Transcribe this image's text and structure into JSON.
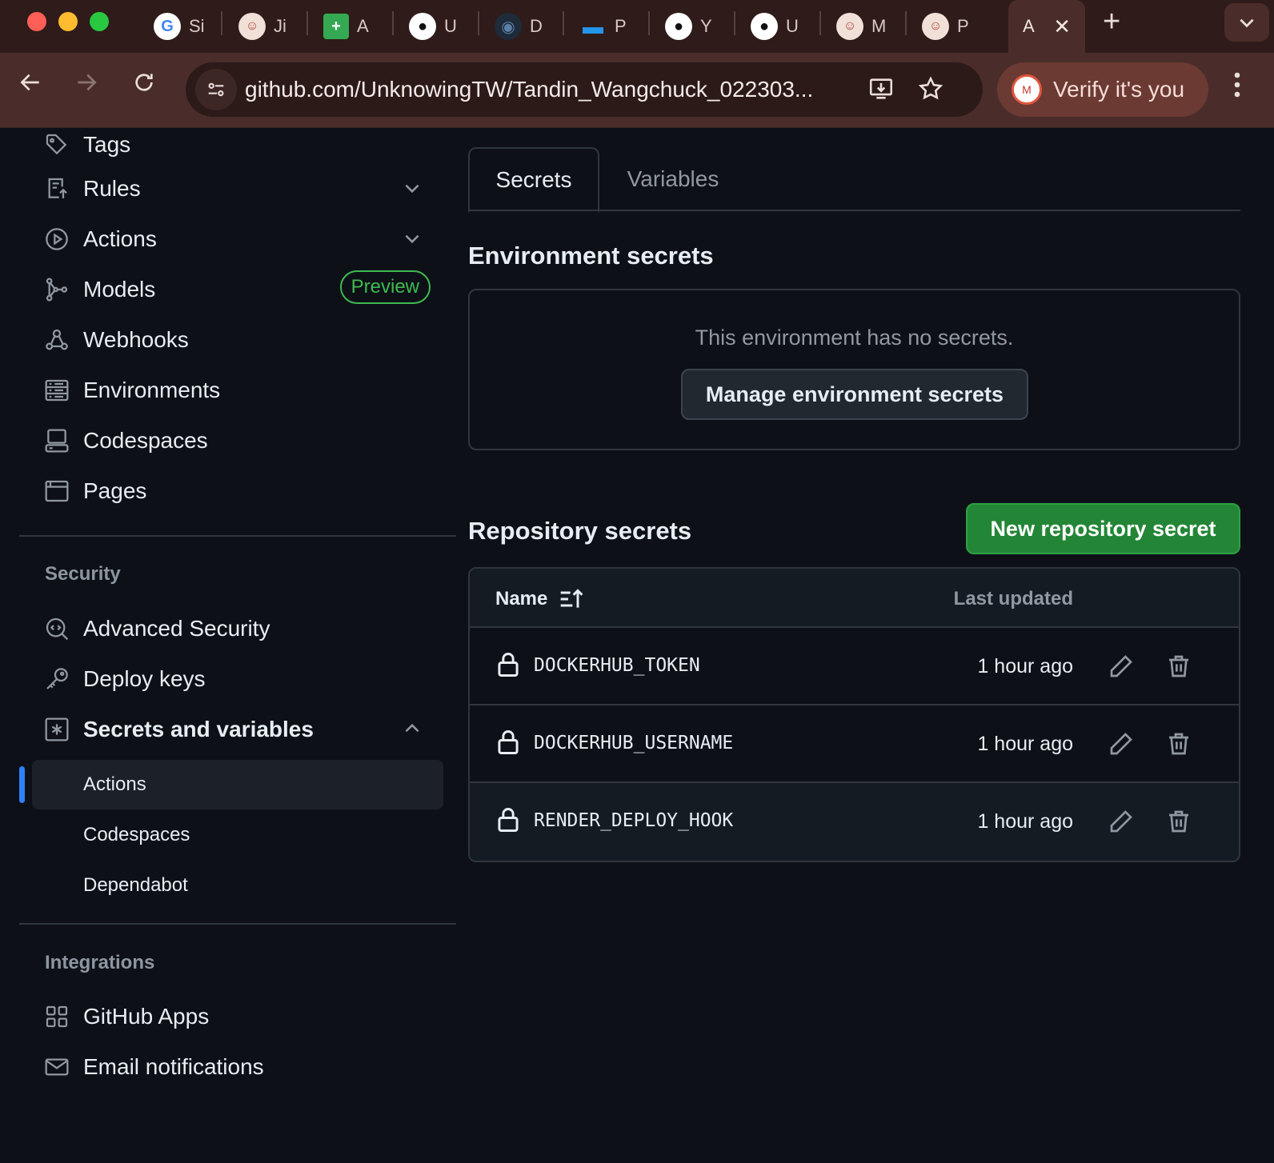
{
  "browser": {
    "tabs": [
      {
        "icon": "google-icon",
        "letter": "Si"
      },
      {
        "icon": "jenkins-icon",
        "letter": "Ji"
      },
      {
        "icon": "sheets-plus-icon",
        "letter": "A"
      },
      {
        "icon": "github-icon",
        "letter": "U"
      },
      {
        "icon": "docker-dark-icon",
        "letter": "D"
      },
      {
        "icon": "docker-icon",
        "letter": "P"
      },
      {
        "icon": "github-icon",
        "letter": "Y"
      },
      {
        "icon": "github-icon",
        "letter": "U"
      },
      {
        "icon": "jenkins-icon",
        "letter": "M"
      },
      {
        "icon": "jenkins-icon",
        "letter": "P"
      }
    ],
    "active_tab_letter": "A",
    "url": "github.com/UnknowingTW/Tandin_Wangchuck_022303...",
    "verify_label": "Verify it's you",
    "avatar_letter": "M",
    "colors": {
      "tabbar": "#2f1b19",
      "toolbar": "#4a2d2a"
    }
  },
  "sidebar": {
    "items": [
      {
        "label": "Tags",
        "icon": "tag-icon"
      },
      {
        "label": "Rules",
        "icon": "rules-icon"
      },
      {
        "label": "Actions",
        "icon": "play-circle-icon"
      },
      {
        "label": "Models",
        "icon": "models-icon"
      },
      {
        "label": "Webhooks",
        "icon": "webhook-icon"
      },
      {
        "label": "Environments",
        "icon": "server-icon"
      },
      {
        "label": "Codespaces",
        "icon": "codespaces-icon"
      },
      {
        "label": "Pages",
        "icon": "browser-icon"
      }
    ],
    "preview_badge": "Preview",
    "security_heading": "Security",
    "security_items": [
      {
        "label": "Advanced Security",
        "icon": "codescan-icon"
      },
      {
        "label": "Deploy keys",
        "icon": "key-icon"
      },
      {
        "label": "Secrets and variables",
        "icon": "asterisk-icon"
      }
    ],
    "sub_items": [
      "Actions",
      "Codespaces",
      "Dependabot"
    ],
    "integrations_heading": "Integrations",
    "integrations_items": [
      {
        "label": "GitHub Apps",
        "icon": "apps-icon"
      },
      {
        "label": "Email notifications",
        "icon": "mail-icon"
      }
    ]
  },
  "main": {
    "tabs": [
      "Secrets",
      "Variables"
    ],
    "env_title": "Environment secrets",
    "env_empty": "This environment has no secrets.",
    "manage_button": "Manage environment secrets",
    "repo_title": "Repository secrets",
    "new_button": "New repository secret",
    "table": {
      "col_name": "Name",
      "col_updated": "Last updated",
      "rows": [
        {
          "name": "DOCKERHUB_TOKEN",
          "updated": "1 hour ago"
        },
        {
          "name": "DOCKERHUB_USERNAME",
          "updated": "1 hour ago"
        },
        {
          "name": "RENDER_DEPLOY_HOOK",
          "updated": "1 hour ago"
        }
      ]
    },
    "colors": {
      "accent": "#2f81f7",
      "primary_button": "#238636",
      "badge": "#3fb950"
    }
  }
}
